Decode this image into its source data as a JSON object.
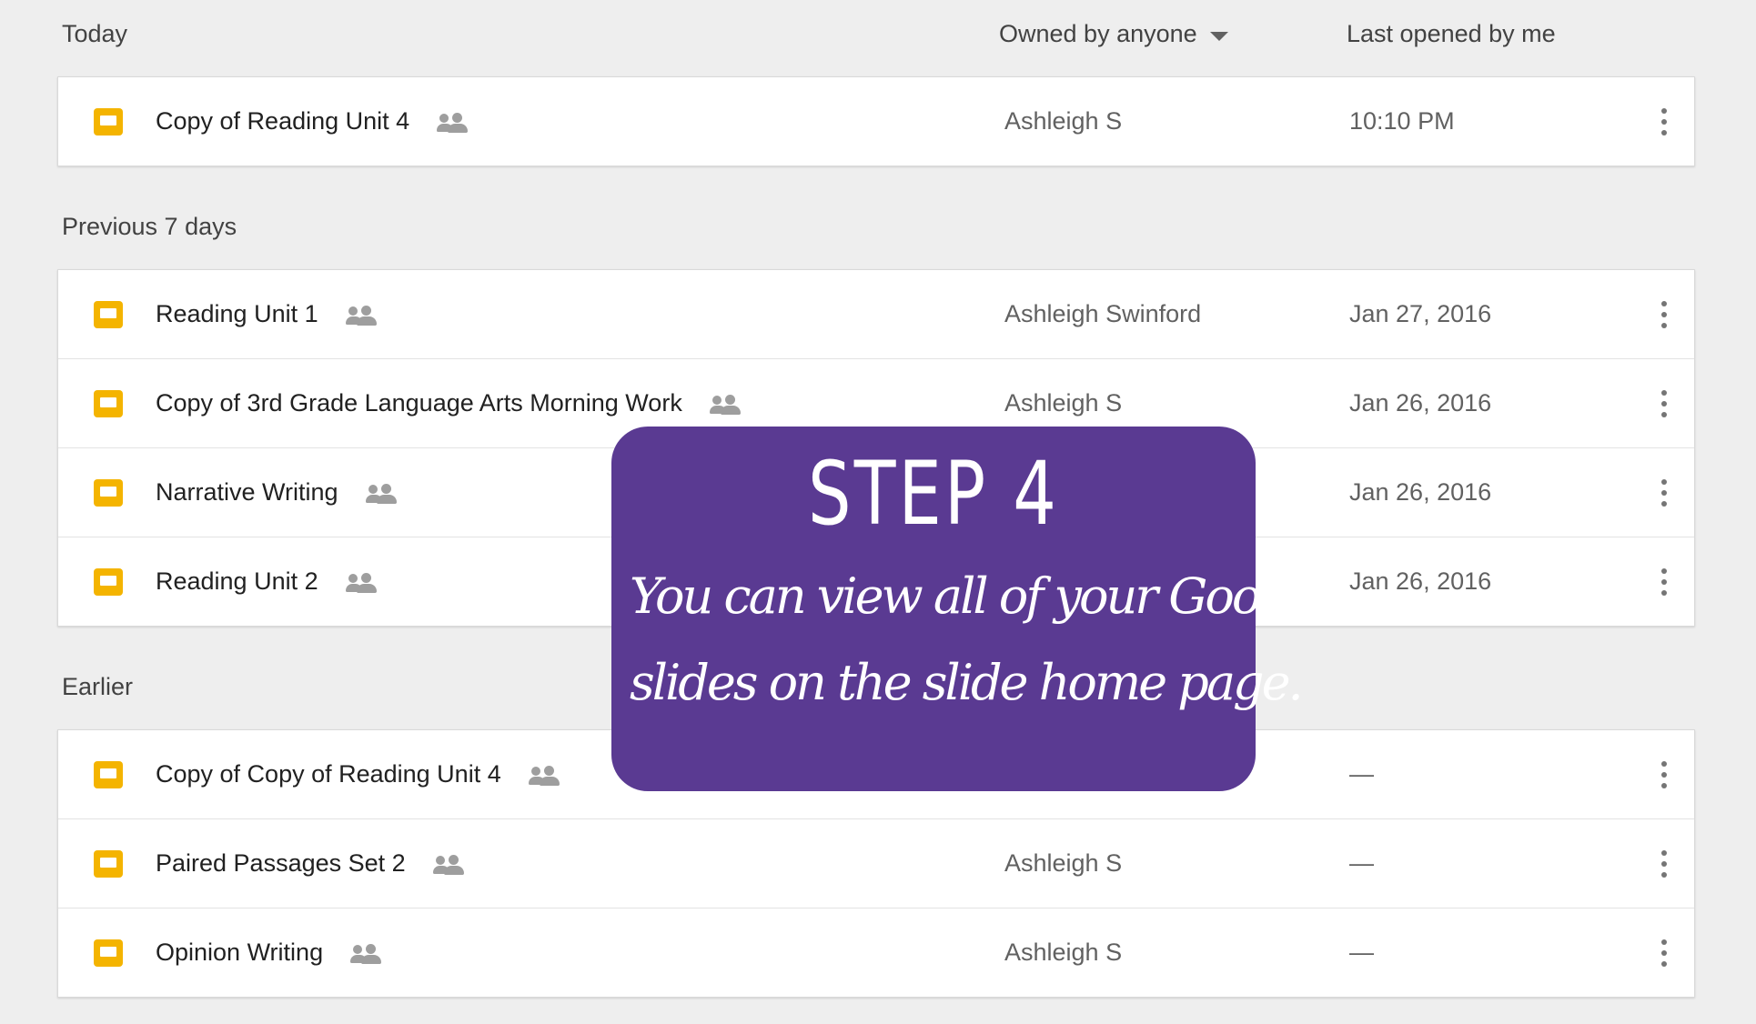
{
  "columns": {
    "owner_filter": "Owned by anyone",
    "last_opened": "Last opened by me"
  },
  "sections": [
    {
      "label": "Today",
      "files": [
        {
          "name": "Copy of Reading Unit 4",
          "owner": "Ashleigh S",
          "date": "10:10 PM"
        }
      ]
    },
    {
      "label": "Previous 7 days",
      "files": [
        {
          "name": "Reading Unit 1",
          "owner": "Ashleigh Swinford",
          "date": "Jan 27, 2016"
        },
        {
          "name": "Copy of 3rd Grade Language Arts Morning Work",
          "owner": "Ashleigh S",
          "date": "Jan 26, 2016"
        },
        {
          "name": "Narrative Writing",
          "owner": "",
          "date": "Jan 26, 2016"
        },
        {
          "name": "Reading Unit 2",
          "owner": "",
          "date": "Jan 26, 2016"
        }
      ]
    },
    {
      "label": "Earlier",
      "files": [
        {
          "name": "Copy of Copy of Reading Unit 4",
          "owner": "",
          "date": "—"
        },
        {
          "name": "Paired Passages Set 2",
          "owner": "Ashleigh S",
          "date": "—"
        },
        {
          "name": "Opinion Writing",
          "owner": "Ashleigh S",
          "date": "—"
        }
      ]
    }
  ],
  "overlay": {
    "title": "STEP 4",
    "line1": "You can view all of your Google",
    "line2": "slides on the slide home page."
  },
  "icons": {
    "file": "slides-file-icon",
    "shared": "shared-people-icon",
    "menu": "more-vert-icon",
    "filter": "dropdown-caret-icon"
  },
  "colors": {
    "background": "#eeeeee",
    "slides_yellow": "#f4b400",
    "overlay_purple": "#5a3a92"
  }
}
